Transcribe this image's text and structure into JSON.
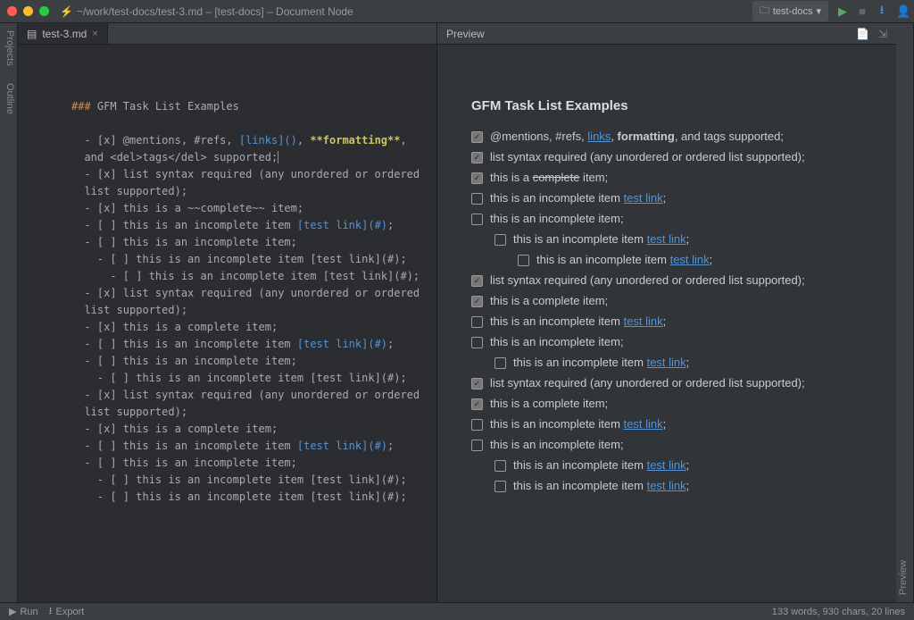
{
  "titlebar": {
    "path": "~/work/test-docs/test-3.md – [test-docs] – Document Node",
    "project": "test-docs"
  },
  "left_rail": {
    "projects": "Projects",
    "outline": "Outline"
  },
  "right_rail": {
    "preview": "Preview"
  },
  "tab": {
    "name": "test-3.md"
  },
  "preview_header": {
    "title": "Preview"
  },
  "editor": {
    "h3_prefix": "###",
    "h3_text": " GFM Task List Examples",
    "l1a": "  - [x] @mentions, #refs, ",
    "l1b": "[links]()",
    "l1c": ", ",
    "l1d": "**formatting**",
    "l1e": ",",
    "l2": "  and <del>tags</del> supported;",
    "l3": "  - [x] list syntax required (any unordered or ordered",
    "l4": "  list supported);",
    "l5": "  - [x] this is a ~~complete~~ item;",
    "l6a": "  - [ ] this is an incomplete item ",
    "l6b": "[test link](#)",
    "l6c": ";",
    "l7": "  - [ ] this is an incomplete item;",
    "l8": "    - [ ] this is an incomplete item [test link](#);",
    "l9": "      - [ ] this is an incomplete item [test link](#);",
    "l10": "  - [x] list syntax required (any unordered or ordered",
    "l11": "  list supported);",
    "l12": "  - [x] this is a complete item;",
    "l13a": "  - [ ] this is an incomplete item ",
    "l13b": "[test link](#)",
    "l13c": ";",
    "l14": "  - [ ] this is an incomplete item;",
    "l15": "    - [ ] this is an incomplete item [test link](#);",
    "l16": "  - [x] list syntax required (any unordered or ordered",
    "l17": "  list supported);",
    "l18": "  - [x] this is a complete item;",
    "l19a": "  - [ ] this is an incomplete item ",
    "l19b": "[test link](#)",
    "l19c": ";",
    "l20": "  - [ ] this is an incomplete item;",
    "l21": "    - [ ] this is an incomplete item [test link](#);",
    "l22": "    - [ ] this is an incomplete item [test link](#);"
  },
  "preview": {
    "h3": "GFM Task List Examples",
    "i1a": "@mentions, #refs, ",
    "i1_link": "links",
    "i1b": ", ",
    "i1_bold": "formatting",
    "i1c": ", and tags supported;",
    "i2": "list syntax required (any unordered or ordered list supported);",
    "i3a": "this is a ",
    "i3_strike": "complete",
    "i3b": " item;",
    "i4a": "this is an incomplete item ",
    "i4_link": "test link",
    "i4b": ";",
    "i5": "this is an incomplete item;",
    "i6a": "this is an incomplete item ",
    "i6_link": "test link",
    "i6b": ";",
    "i7a": "this is an incomplete item ",
    "i7_link": "test link",
    "i7b": ";",
    "i8": "list syntax required (any unordered or ordered list supported);",
    "i9": "this is a complete item;",
    "i10a": "this is an incomplete item ",
    "i10_link": "test link",
    "i10b": ";",
    "i11": "this is an incomplete item;",
    "i12a": "this is an incomplete item ",
    "i12_link": "test link",
    "i12b": ";",
    "i13": "list syntax required (any unordered or ordered list supported);",
    "i14": "this is a complete item;",
    "i15a": "this is an incomplete item ",
    "i15_link": "test link",
    "i15b": ";",
    "i16": "this is an incomplete item;",
    "i17a": "this is an incomplete item ",
    "i17_link": "test link",
    "i17b": ";",
    "i18a": "this is an incomplete item ",
    "i18_link": "test link",
    "i18b": ";"
  },
  "statusbar": {
    "run": "Run",
    "export": "Export",
    "info": "133 words, 930 chars, 20 lines"
  }
}
